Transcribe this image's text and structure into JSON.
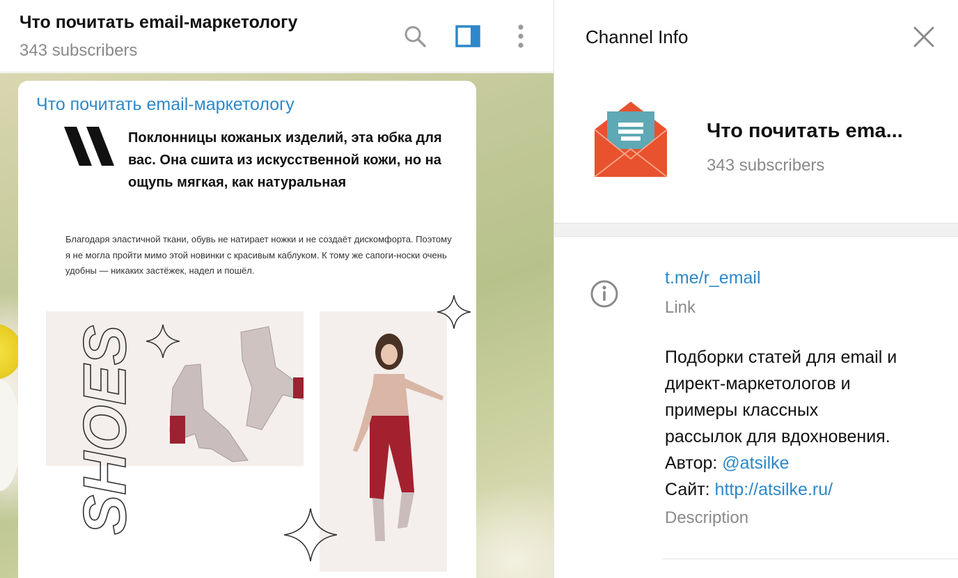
{
  "chat": {
    "title": "Что почитать email-маркетологу",
    "subscribers": "343 subscribers",
    "header_icons": [
      "search-icon",
      "side-panel-icon",
      "more-vertical-icon"
    ],
    "accent_color": "#2e88c9"
  },
  "message": {
    "sender": "Что почитать email-маркетологу",
    "post_heading": "Поклонницы кожаных изделий, эта юбка для вас. Она сшита из искусственной кожи, но на ощупь мягкая, как натуральная",
    "post_body": "Благодаря эластичной ткани, обувь не натирает ножки и не создаёт дискомфорта. Поэтому я не могла пройти мимо этой новинки с красивым каблуком. К тому же сапоги-носки очень удобны — никаких застёжек, надел и пошёл.",
    "shoes_word": "SHOES"
  },
  "info_panel": {
    "title": "Channel Info",
    "channel_name": "Что почитать ema...",
    "subscribers": "343 subscribers",
    "link_value": "t.me/r_email",
    "link_label": "Link",
    "description_lines": [
      "Подборки статей для email и",
      "директ-маркетологов и",
      "примеры классных",
      "рассылок для вдохновения."
    ],
    "author_label": "Автор: ",
    "author_handle": "@atsilke",
    "site_label": "Сайт: ",
    "site_url": "http://atsilke.ru/",
    "description_label": "Description"
  }
}
